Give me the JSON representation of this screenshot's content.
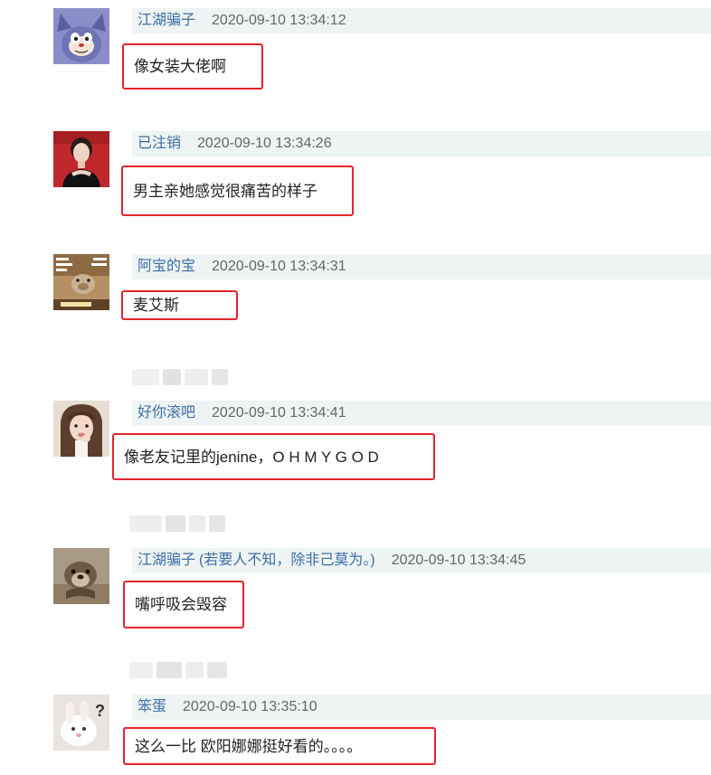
{
  "comments": [
    {
      "username": "江湖骗子",
      "note": "",
      "timestamp": "2020-09-10 13:34:12",
      "text": "像女装大佬啊",
      "avatar_icon": "tom-cat-avatar-icon"
    },
    {
      "username": "已注销",
      "note": "",
      "timestamp": "2020-09-10 13:34:26",
      "text": "男主亲她感觉很痛苦的样子",
      "avatar_icon": "woman-portrait-avatar-icon"
    },
    {
      "username": "阿宝的宝",
      "note": "",
      "timestamp": "2020-09-10 13:34:31",
      "text": "麦艾斯",
      "avatar_icon": "meme-pig-avatar-icon"
    },
    {
      "username": "好你滚吧",
      "note": "",
      "timestamp": "2020-09-10 13:34:41",
      "text": "像老友记里的jenine，O H M Y G O D",
      "avatar_icon": "girl-portrait-avatar-icon"
    },
    {
      "username": "江湖骗子",
      "note": "(若要人不知，除非己莫为。)",
      "timestamp": "2020-09-10 13:34:45",
      "text": "嘴呼吸会毁容",
      "avatar_icon": "otter-avatar-icon"
    },
    {
      "username": "笨蛋",
      "note": "",
      "timestamp": "2020-09-10 13:35:10",
      "text": "这么一比 欧阳娜娜挺好看的。。。。",
      "avatar_icon": "bunny-question-avatar-icon"
    }
  ],
  "colors": {
    "username": "#3d6fa5",
    "timestamp": "#666666",
    "meta_bar_bg": "#eef3f3",
    "highlight_border": "#e4242c",
    "content_text": "#222222"
  }
}
